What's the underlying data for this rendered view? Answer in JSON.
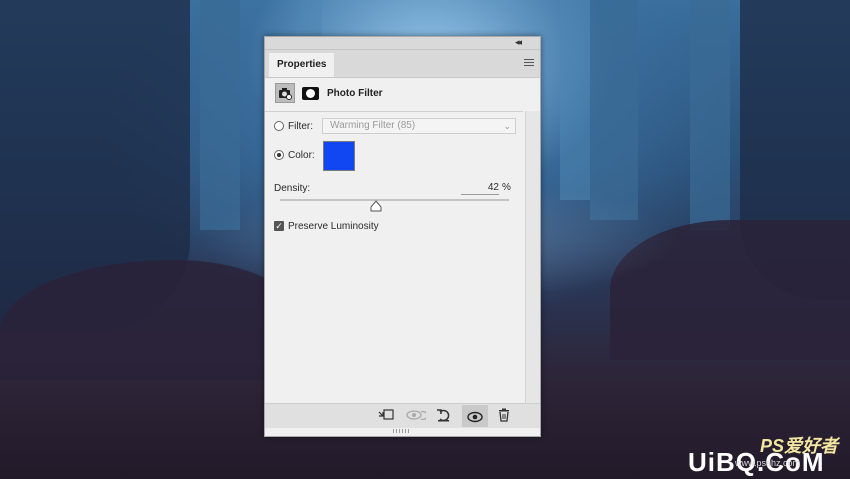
{
  "panel": {
    "tab_label": "Properties",
    "collapse_glyph": "◂◂",
    "close_glyph": "✕",
    "adjustment_title": "Photo Filter",
    "filter": {
      "label": "Filter:",
      "value": "Warming Filter (85)",
      "selected": false
    },
    "color": {
      "label": "Color:",
      "selected": true,
      "swatch": "#1047f2"
    },
    "density": {
      "label": "Density:",
      "value": "42",
      "unit": "%",
      "level": 0.42
    },
    "preserve_luminosity": {
      "label": "Preserve Luminosity",
      "checked": true
    },
    "bottom_icons": [
      "clip-to-layer-icon",
      "view-previous-state-icon",
      "reset-icon",
      "visibility-eye-icon",
      "trash-icon"
    ]
  },
  "watermark": {
    "logo": "PS爱好者",
    "brand": "UiBQ.CoM",
    "sub": "www.psahz.com"
  }
}
